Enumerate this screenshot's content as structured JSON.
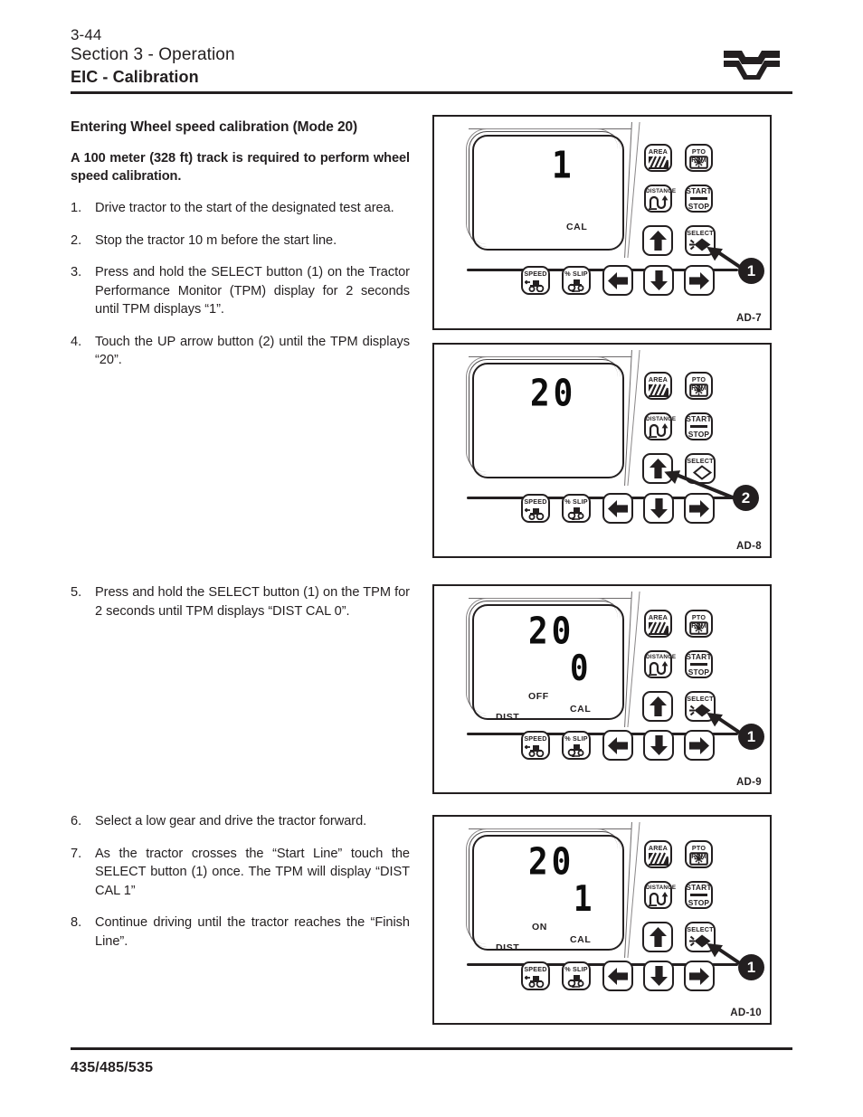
{
  "header": {
    "page_number": "3-44",
    "section": "Section 3 - Operation",
    "title": "EIC - Calibration",
    "logo_name": "valtra-v-logo"
  },
  "content": {
    "heading": "Entering Wheel speed calibration (Mode 20)",
    "lead": "A 100 meter (328 ft) track is required to perform wheel speed calibration.",
    "steps": [
      {
        "num": "1.",
        "text": "Drive tractor to the start of the designated test area."
      },
      {
        "num": "2.",
        "text": "Stop the tractor 10 m before the start line."
      },
      {
        "num": "3.",
        "text": "Press and hold the SELECT button (1) on the Tractor Performance Monitor (TPM) display for 2 seconds until TPM displays “1”."
      },
      {
        "num": "4.",
        "text": "Touch the UP arrow button (2) until the TPM displays “20”."
      },
      {
        "num": "5.",
        "text": "Press and hold the SELECT button (1) on the TPM for 2 seconds until TPM displays “DIST CAL 0”."
      },
      {
        "num": "6.",
        "text": "Select a low gear and drive the tractor forward."
      },
      {
        "num": "7.",
        "text": "As the tractor crosses the “Start Line” touch the SELECT button (1) once. The TPM will display “DIST CAL 1”"
      },
      {
        "num": "8.",
        "text": "Continue driving until the tractor reaches the “Finish Line”."
      }
    ]
  },
  "keypad": {
    "area": "AREA",
    "pto_rpm": "PTO RPM",
    "distance": "DISTANCE",
    "start": "START",
    "stop": "STOP",
    "select": "SELECT",
    "speed": "SPEED",
    "slip": "% SLIP"
  },
  "figures": [
    {
      "id": "AD-7",
      "display": {
        "main": "1",
        "sub": "",
        "labels": {
          "cal": "CAL",
          "dist": "",
          "onoff": ""
        }
      },
      "callout": {
        "number": "1",
        "target": "select-button"
      }
    },
    {
      "id": "AD-8",
      "display": {
        "main": "20",
        "sub": "",
        "labels": {
          "cal": "",
          "dist": "",
          "onoff": ""
        }
      },
      "callout": {
        "number": "2",
        "target": "up-arrow-button"
      }
    },
    {
      "id": "AD-9",
      "display": {
        "main": "20",
        "sub": "0",
        "labels": {
          "cal": "CAL",
          "dist": "DIST",
          "onoff": "OFF"
        }
      },
      "callout": {
        "number": "1",
        "target": "select-button"
      }
    },
    {
      "id": "AD-10",
      "display": {
        "main": "20",
        "sub": "1",
        "labels": {
          "cal": "CAL",
          "dist": "DIST",
          "onoff": "ON"
        }
      },
      "callout": {
        "number": "1",
        "target": "select-button"
      }
    }
  ],
  "footer": {
    "models": "435/485/535"
  },
  "colors": {
    "ink": "#231f20",
    "paper": "#ffffff"
  }
}
